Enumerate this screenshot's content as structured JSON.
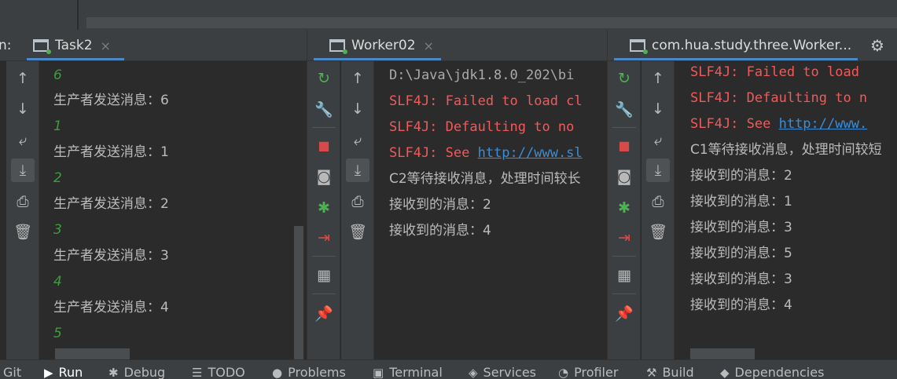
{
  "topbar": {},
  "panel1": {
    "truncated_label": "n:",
    "tab": "Task2",
    "close": "×",
    "lines": [
      {
        "text": "6",
        "kind": "green"
      },
      {
        "text": "生产者发送消息：6",
        "kind": "normal"
      },
      {
        "text": "1",
        "kind": "green"
      },
      {
        "text": "生产者发送消息：1",
        "kind": "normal"
      },
      {
        "text": "2",
        "kind": "green"
      },
      {
        "text": "生产者发送消息：2",
        "kind": "normal"
      },
      {
        "text": "3",
        "kind": "green"
      },
      {
        "text": "生产者发送消息：3",
        "kind": "normal"
      },
      {
        "text": "4",
        "kind": "green"
      },
      {
        "text": "生产者发送消息：4",
        "kind": "normal"
      },
      {
        "text": "5",
        "kind": "green"
      }
    ]
  },
  "panel2": {
    "tab": "Worker02",
    "close": "×",
    "lines": {
      "path": "D:\\Java\\jdk1.8.0_202\\bi",
      "slf1": "SLF4J: Failed to load cl",
      "slf2": "SLF4J: Defaulting to no",
      "slf3_prefix": "SLF4J: See ",
      "slf3_link": "http://www.sl",
      "c2": "C2等待接收消息，处理时间较长",
      "r1": "接收到的消息：2",
      "r2": "接收到的消息：4"
    }
  },
  "panel3": {
    "tab": "com.hua.study.three.Worker...",
    "lines": {
      "slf1": "SLF4J: Failed to load",
      "slf2": "SLF4J: Defaulting to n",
      "slf3_prefix": "SLF4J: See ",
      "slf3_link": "http://www.",
      "c1": "C1等待接收消息，处理时间较短",
      "received": [
        "接收到的消息：2",
        "接收到的消息：1",
        "接收到的消息：3",
        "接收到的消息：5",
        "接收到的消息：3",
        "接收到的消息：4"
      ]
    }
  },
  "bottom": {
    "git": "Git",
    "run": "Run",
    "debug": "Debug",
    "todo": "TODO",
    "problems": "Problems",
    "terminal": "Terminal",
    "services": "Services",
    "profiler": "Profiler",
    "build": "Build",
    "dependencies": "Dependencies"
  },
  "colors": {
    "background": "#2b2b2b",
    "toolbar": "#3c3f41",
    "error_red": "#f05a5a",
    "link_blue": "#3b8dd9",
    "green": "#3f9b3f",
    "tab_accent": "#4a88c7"
  },
  "icons": [
    "up-arrow-icon",
    "down-arrow-icon",
    "soft-wrap-icon",
    "scroll-to-end-icon",
    "print-icon",
    "trash-icon",
    "rerun-icon",
    "wrench-icon",
    "stop-icon",
    "camera-icon",
    "debug-bug-icon",
    "exit-icon",
    "layout-icon",
    "pin-icon",
    "gear-icon"
  ]
}
